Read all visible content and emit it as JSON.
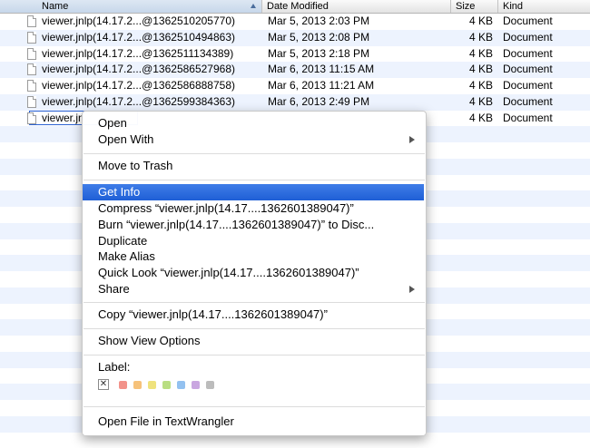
{
  "columns": {
    "name": "Name",
    "date": "Date Modified",
    "size": "Size",
    "kind": "Kind"
  },
  "files": [
    {
      "name": "viewer.jnlp(14.17.2...@1362510205770)",
      "date": "Mar 5, 2013 2:03 PM",
      "size": "4 KB",
      "kind": "Document"
    },
    {
      "name": "viewer.jnlp(14.17.2...@1362510494863)",
      "date": "Mar 5, 2013 2:08 PM",
      "size": "4 KB",
      "kind": "Document"
    },
    {
      "name": "viewer.jnlp(14.17.2...@1362511134389)",
      "date": "Mar 5, 2013 2:18 PM",
      "size": "4 KB",
      "kind": "Document"
    },
    {
      "name": "viewer.jnlp(14.17.2...@1362586527968)",
      "date": "Mar 6, 2013 11:15 AM",
      "size": "4 KB",
      "kind": "Document"
    },
    {
      "name": "viewer.jnlp(14.17.2...@1362586888758)",
      "date": "Mar 6, 2013 11:21 AM",
      "size": "4 KB",
      "kind": "Document"
    },
    {
      "name": "viewer.jnlp(14.17.2...@1362599384363)",
      "date": "Mar 6, 2013 2:49 PM",
      "size": "4 KB",
      "kind": "Document"
    },
    {
      "name": "viewer.jn",
      "date": "",
      "size": "4 KB",
      "kind": "Document"
    }
  ],
  "menu": {
    "open": "Open",
    "open_with": "Open With",
    "move_to_trash": "Move to Trash",
    "get_info": "Get Info",
    "compress": "Compress “viewer.jnlp(14.17....1362601389047)”",
    "burn": "Burn “viewer.jnlp(14.17....1362601389047)” to Disc...",
    "duplicate": "Duplicate",
    "make_alias": "Make Alias",
    "quick_look": "Quick Look “viewer.jnlp(14.17....1362601389047)”",
    "share": "Share",
    "copy": "Copy “viewer.jnlp(14.17....1362601389047)”",
    "show_view_options": "Show View Options",
    "label": "Label:",
    "label_none_glyph": "✕",
    "open_in_textwrangler": "Open File in TextWrangler"
  },
  "label_colors": [
    "#f2928a",
    "#f6c27a",
    "#efe27d",
    "#b9de82",
    "#93c1f0",
    "#c9a6e0",
    "#bcbcbc"
  ],
  "colors": {
    "highlight": "#2c67d9",
    "row_alt": "#edf3fe"
  }
}
